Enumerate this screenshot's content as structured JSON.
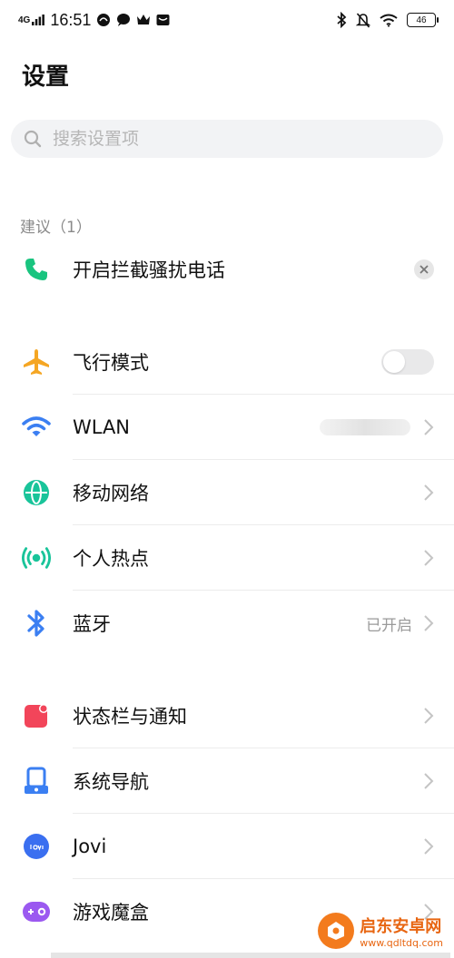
{
  "status_bar": {
    "network": "4G",
    "time": "16:51",
    "battery": "46"
  },
  "page": {
    "title": "设置"
  },
  "search": {
    "placeholder": "搜索设置项"
  },
  "suggestion": {
    "section_label": "建议（1）",
    "item_label": "开启拦截骚扰电话"
  },
  "groups": {
    "network": [
      {
        "label": "飞行模式",
        "control": "toggle",
        "checked": false
      },
      {
        "label": "WLAN",
        "value": ""
      },
      {
        "label": "移动网络"
      },
      {
        "label": "个人热点"
      },
      {
        "label": "蓝牙",
        "value": "已开启"
      }
    ],
    "system": [
      {
        "label": "状态栏与通知"
      },
      {
        "label": "系统导航"
      },
      {
        "label": "Jovi"
      },
      {
        "label": "游戏魔盒"
      }
    ]
  },
  "watermark": {
    "title": "启东安卓网",
    "url": "www.qdltdq.com"
  },
  "colors": {
    "phone": "#19c47f",
    "airplane": "#f5a623",
    "wifi": "#3b7ff2",
    "mobile": "#19c49a",
    "hotspot": "#19c49a",
    "bluetooth": "#3b7ff2",
    "statusbar_notify": "#f2455a",
    "navigation": "#3b7ff2",
    "jovi": "#3a6ff0",
    "game": "#9b59f0"
  }
}
